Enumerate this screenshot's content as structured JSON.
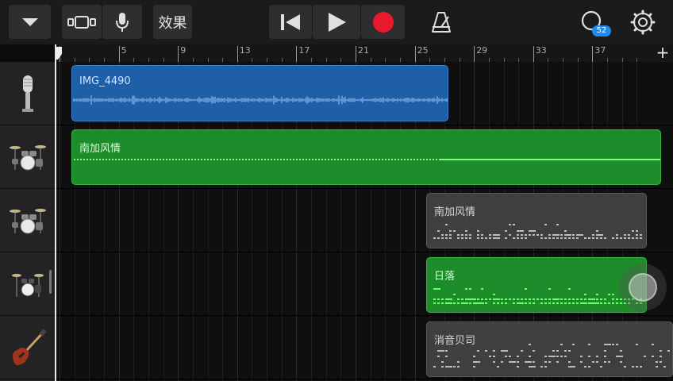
{
  "toolbar": {
    "buttons": [
      {
        "name": "view-menu",
        "icon": "triangle-down-icon"
      },
      {
        "name": "tracks-view",
        "icon": "tracks-view-icon"
      },
      {
        "name": "instrument",
        "icon": "microphone-icon"
      },
      {
        "name": "fx",
        "label": "效果"
      },
      {
        "name": "go-to-beginning",
        "icon": "skip-back-icon"
      },
      {
        "name": "play",
        "icon": "play-icon"
      },
      {
        "name": "record",
        "icon": "record-icon"
      },
      {
        "name": "metronome",
        "icon": "metronome-icon"
      },
      {
        "name": "loops",
        "icon": "loop-icon",
        "badge": "52"
      },
      {
        "name": "settings",
        "icon": "gear-icon"
      }
    ],
    "record_color": "#e8192c",
    "badge_color": "#1c8cf2"
  },
  "ruler": {
    "labels": [
      "5",
      "9",
      "13",
      "17",
      "21",
      "25",
      "29",
      "33",
      "37"
    ],
    "add_label": "+"
  },
  "tracks": [
    {
      "instrument": "microphone-icon"
    },
    {
      "instrument": "drum-kit-icon"
    },
    {
      "instrument": "drum-kit-icon"
    },
    {
      "instrument": "drum-kit-icon"
    },
    {
      "instrument": "bass-guitar-icon"
    }
  ],
  "regions": [
    {
      "name": "IMG_4490",
      "type": "audio",
      "color": "#1f5fa8"
    },
    {
      "name": "南加风情",
      "type": "drummer",
      "color": "#1d8c2a"
    },
    {
      "name": "南加风情",
      "type": "pattern",
      "color": "#3f3f41"
    },
    {
      "name": "日落",
      "type": "pattern",
      "color": "#1d8c2a"
    },
    {
      "name": "消音贝司",
      "type": "pattern",
      "color": "#3f3f41"
    }
  ]
}
